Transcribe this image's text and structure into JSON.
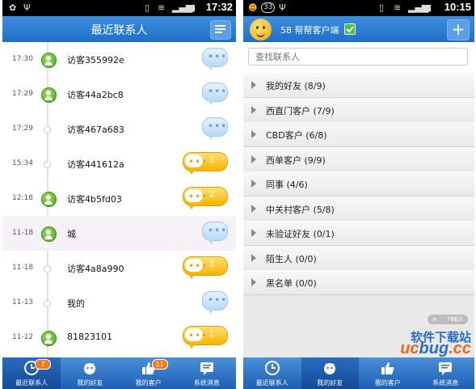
{
  "left": {
    "status_time": "17:32",
    "title": "最近联系人",
    "contacts": [
      {
        "time": "17:30",
        "name": "访客355992e",
        "online": true,
        "unread": ""
      },
      {
        "time": "17:29",
        "name": "访客44a2bc8",
        "online": true,
        "unread": ""
      },
      {
        "time": "17:29",
        "name": "访客467a683",
        "online": false,
        "unread": ""
      },
      {
        "time": "15:34",
        "name": "访客441612a",
        "online": false,
        "unread": "1"
      },
      {
        "time": "12:18",
        "name": "访客4b5fd03",
        "online": true,
        "unread": "2"
      },
      {
        "time": "11-18",
        "name": "城",
        "online": true,
        "unread": ""
      },
      {
        "time": "11-18",
        "name": "访客4a8a990",
        "online": false,
        "unread": "3"
      },
      {
        "time": "11-13",
        "name": "我的",
        "online": false,
        "unread": ""
      },
      {
        "time": "11-12",
        "name": "81823101",
        "online": true,
        "unread": "1"
      }
    ],
    "tabs": [
      {
        "label": "最近联系人",
        "badge": "7",
        "icon": "clock-icon"
      },
      {
        "label": "我的好友",
        "badge": "",
        "icon": "face-icon"
      },
      {
        "label": "我的客户",
        "badge": "11",
        "icon": "thumbs-up-icon"
      },
      {
        "label": "系统消息",
        "badge": "",
        "icon": "message-icon"
      }
    ]
  },
  "right": {
    "status_time": "10:15",
    "status_badge": "33",
    "app_title": "58 帮帮客户端",
    "search_placeholder": "查找联系人",
    "groups": [
      {
        "label": "我的好友 (8/9)"
      },
      {
        "label": "西直门客户 (7/9)"
      },
      {
        "label": "CBD客户 (6/8)"
      },
      {
        "label": "西单客户 (9/9)"
      },
      {
        "label": "同事 (4/6)"
      },
      {
        "label": "中关村客户 (5/8)"
      },
      {
        "label": "未验证好友 (0/1)"
      },
      {
        "label": "陌生人 (0/0)"
      },
      {
        "label": "黑名单 (0/0)"
      }
    ],
    "net_rate": "76B/S",
    "tabs": [
      {
        "label": "最近联系人",
        "icon": "clock-icon"
      },
      {
        "label": "我的好友",
        "icon": "face-icon"
      },
      {
        "label": "我的客户",
        "icon": "thumbs-up-icon"
      },
      {
        "label": "系统消息",
        "icon": "message-icon"
      }
    ]
  },
  "watermark": {
    "line1": "软件下载站",
    "line2a": "uc",
    "line2b": "bug",
    "line2c": ".cc"
  },
  "colors": {
    "title_bar": "#2b7fd6",
    "unread": "#f5b400",
    "online": "#4ea820"
  }
}
